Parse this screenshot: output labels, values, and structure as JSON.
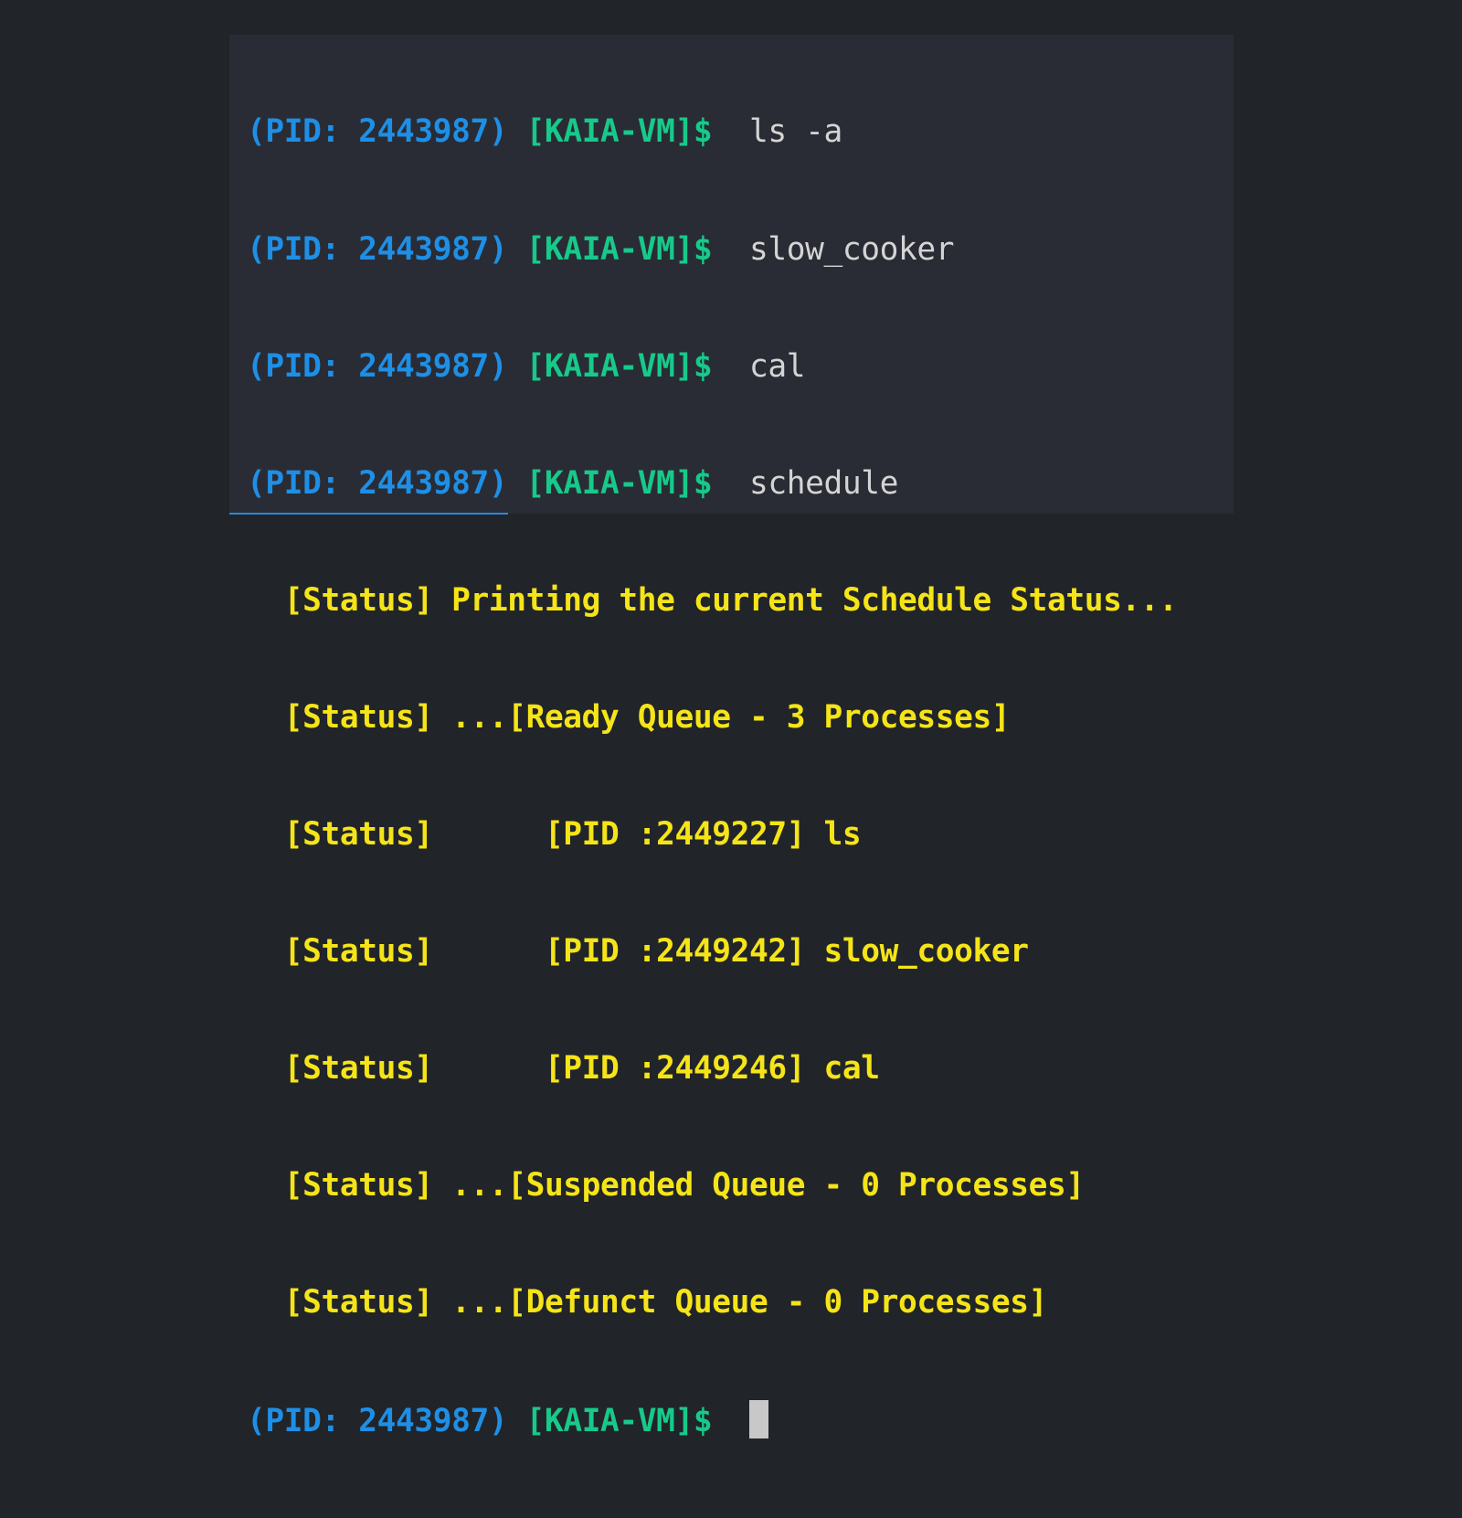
{
  "terminal": {
    "prompt_pid": "(PID: 2443987)",
    "prompt_host": "[KAIA-VM]$",
    "commands": [
      "ls -a",
      "slow_cooker",
      "cal",
      "schedule"
    ],
    "status_lines": [
      "[Status] Printing the current Schedule Status...",
      "[Status] ...[Ready Queue - 3 Processes]",
      "[Status]      [PID :2449227] ls",
      "[Status]      [PID :2449242] slow_cooker",
      "[Status]      [PID :2449246] cal",
      "[Status] ...[Suspended Queue - 0 Processes]",
      "[Status] ...[Defunct Queue - 0 Processes]"
    ],
    "colors": {
      "background": "#212429",
      "panel": "#292c34",
      "pid": "#1e8fe6",
      "host": "#17c98a",
      "command": "#d4d4d4",
      "status": "#f5e418",
      "cursor": "#c8c8c8"
    }
  }
}
